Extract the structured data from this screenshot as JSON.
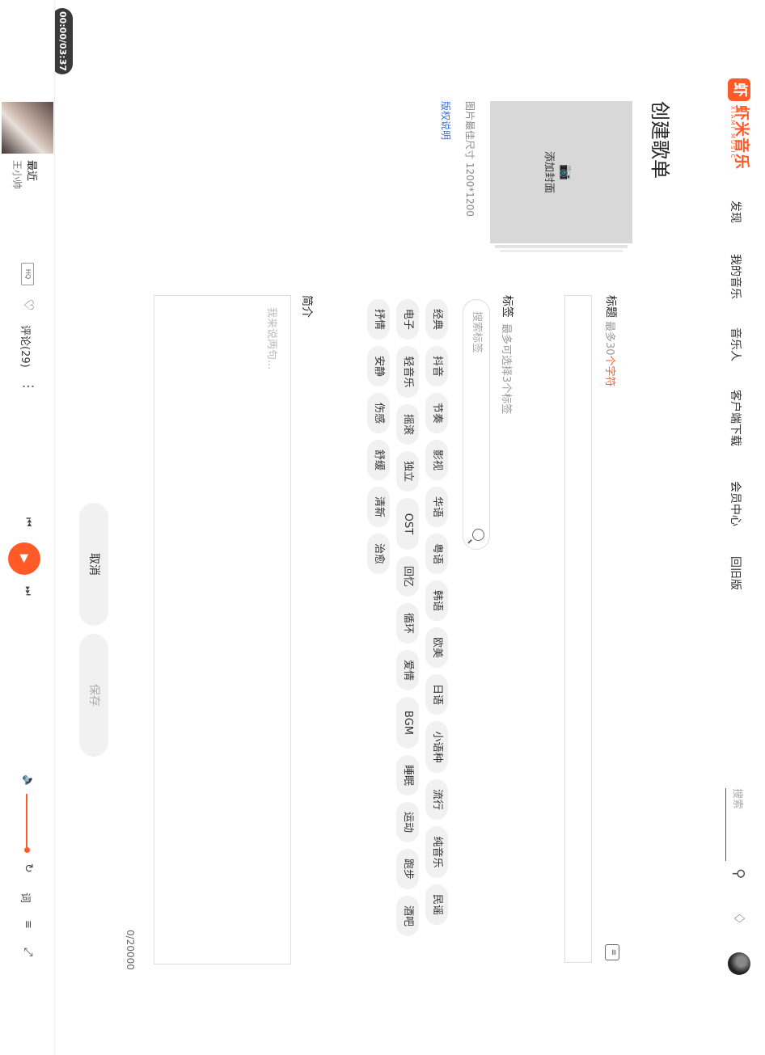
{
  "brand": {
    "logo_char": "虾",
    "name": "虾米音乐",
    "sub": "XIAMI MUSIC",
    "accent": "#ff5a28"
  },
  "nav": [
    "发现",
    "我的音乐",
    "音乐人",
    "客户端下载",
    "会员中心",
    "回旧版"
  ],
  "header": {
    "search_placeholder": "搜索",
    "icons": [
      "search-icon",
      "bell-icon",
      "user-avatar"
    ]
  },
  "page": {
    "title": "创建歌单",
    "cover": {
      "icon": "camera-icon",
      "label": "添加封面",
      "hint": "图片最佳尺寸 1200*1200",
      "link": "版权说明"
    },
    "title_field": {
      "label": "标题",
      "hint_prefix": "最多30",
      "hint_accent": "个字符",
      "value": ""
    },
    "tags_field": {
      "label": "标签",
      "hint": "最多可选择3个标签",
      "search_placeholder": "搜索标签"
    },
    "tags": [
      [
        "经典",
        "抖音",
        "节奏",
        "影视",
        "华语",
        "粤语",
        "韩语",
        "欧美",
        "日语",
        "小语种",
        "流行",
        "纯音乐",
        "民谣"
      ],
      [
        "电子",
        "轻音乐",
        "摇滚",
        "独立",
        "OST",
        "回忆",
        "循环",
        "爱情",
        "BGM",
        "睡眠",
        "运动",
        "跑步",
        "酒吧"
      ],
      [
        "抒情",
        "安静",
        "伤感",
        "舒缓",
        "清新",
        "治愈"
      ]
    ],
    "intro_field": {
      "label": "简介",
      "placeholder": "我来说两句...",
      "counter": "0/20000"
    },
    "buttons": {
      "cancel": "取消",
      "save": "保存"
    }
  },
  "timer": "00:00/03:37",
  "player": {
    "song": "最近",
    "artist": "王小帅",
    "quality": "HQ",
    "comment": "评论(29)",
    "more": "⋮"
  }
}
